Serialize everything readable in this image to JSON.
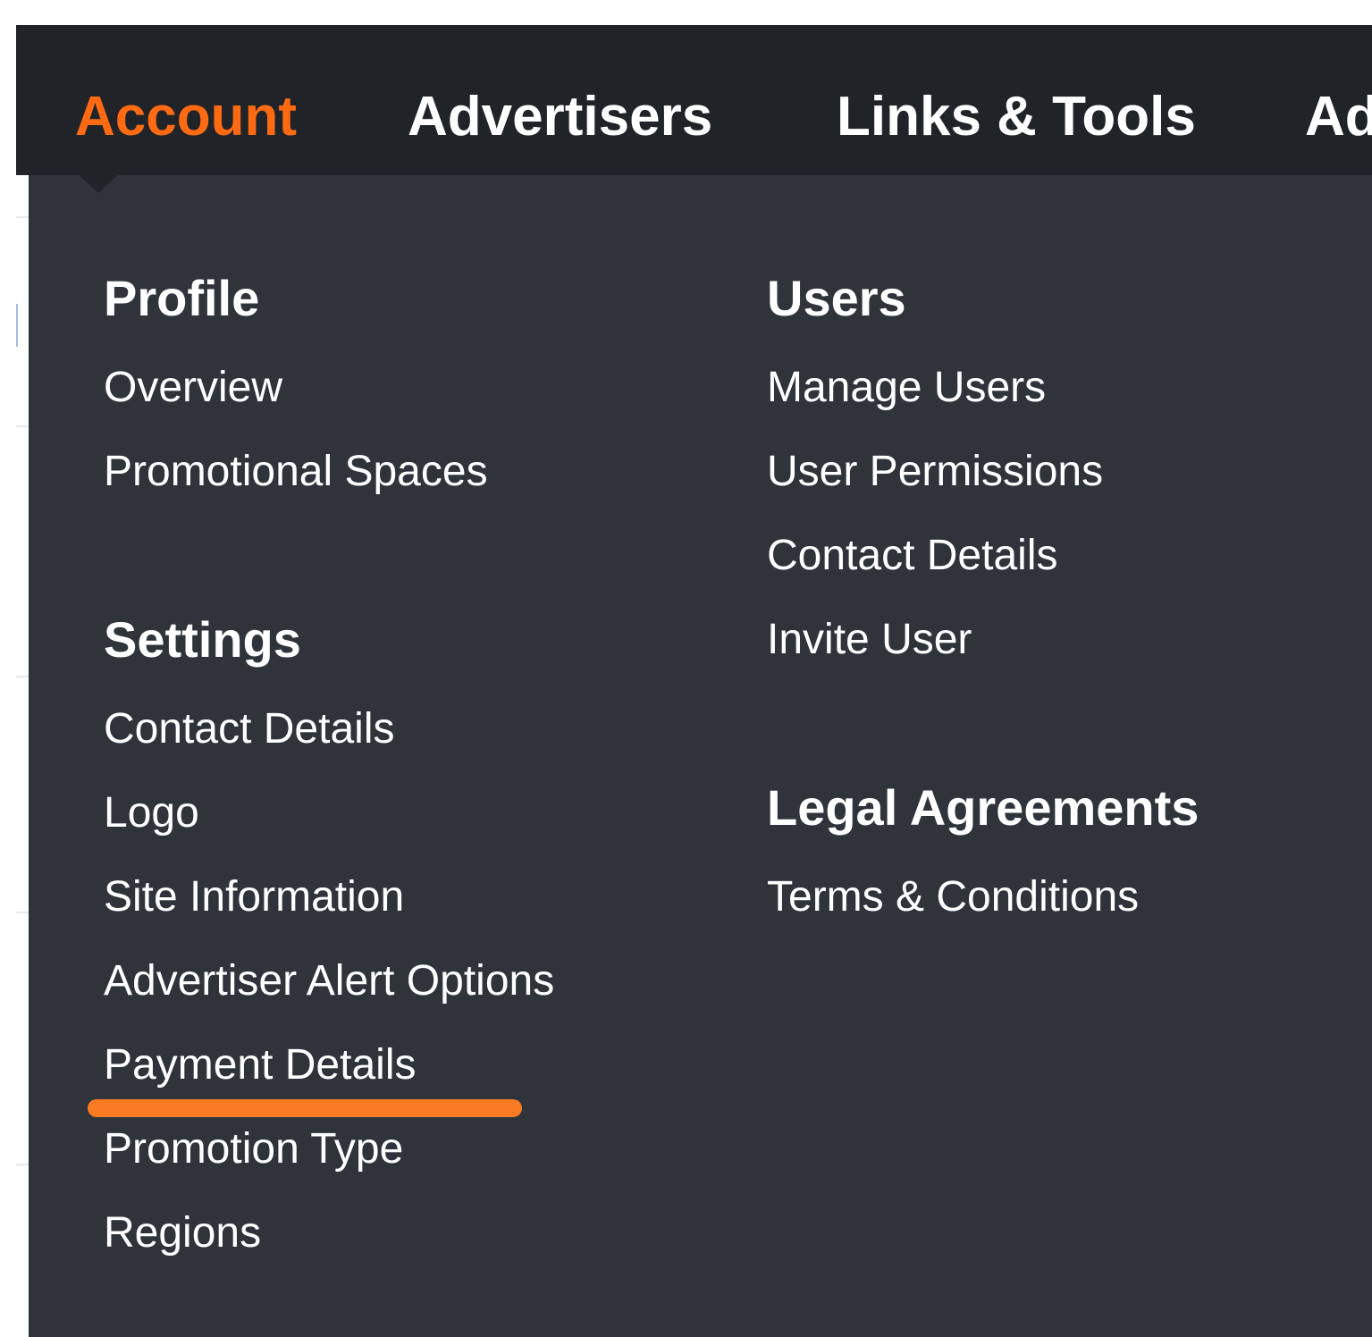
{
  "nav": {
    "items": [
      {
        "label": "Account",
        "active": true
      },
      {
        "label": "Advertisers",
        "active": false
      },
      {
        "label": "Links & Tools",
        "active": false
      },
      {
        "label": "Ad",
        "active": false
      }
    ],
    "colors": {
      "bar_bg": "#202428",
      "active": "#ff6a13",
      "text": "#ffffff"
    }
  },
  "dropdown": {
    "bg_color": "#2f343b",
    "profile": {
      "title": "Profile",
      "links": [
        "Overview",
        "Promotional Spaces"
      ]
    },
    "settings": {
      "title": "Settings",
      "links": [
        "Contact Details",
        "Logo",
        "Site Information",
        "Advertiser Alert Options",
        "Payment Details",
        "Promotion Type",
        "Regions"
      ],
      "highlighted": "Payment Details",
      "highlight_color": "#fa7a24"
    },
    "users": {
      "title": "Users",
      "links": [
        "Manage Users",
        "User Permissions",
        "Contact Details",
        "Invite User"
      ]
    },
    "legal": {
      "title": "Legal Agreements",
      "links": [
        "Terms & Conditions"
      ]
    }
  }
}
